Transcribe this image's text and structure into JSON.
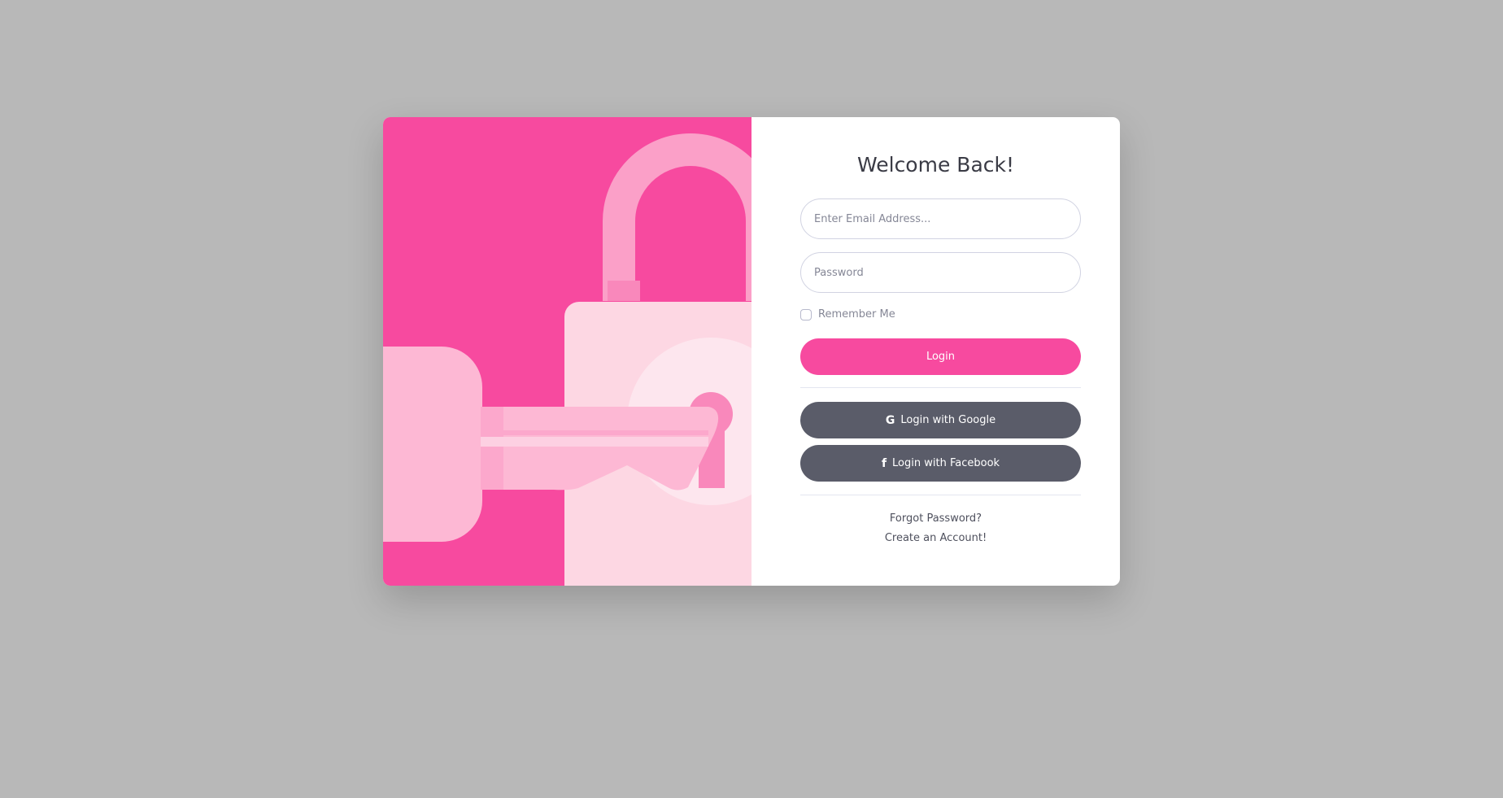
{
  "form": {
    "title": "Welcome Back!",
    "email_placeholder": "Enter Email Address...",
    "email_value": "",
    "password_placeholder": "Password",
    "password_value": "",
    "remember_label": "Remember Me",
    "remember_checked": false,
    "login_label": "Login",
    "google_label": "Login with Google",
    "facebook_label": "Login with Facebook",
    "forgot_label": "Forgot Password?",
    "create_label": "Create an Account!"
  },
  "icons": {
    "google": "google-icon",
    "facebook": "facebook-icon"
  },
  "colors": {
    "primary": "#f74a9f",
    "social_button": "#5a5c69",
    "background": "#b8b8b8",
    "card": "#ffffff"
  }
}
